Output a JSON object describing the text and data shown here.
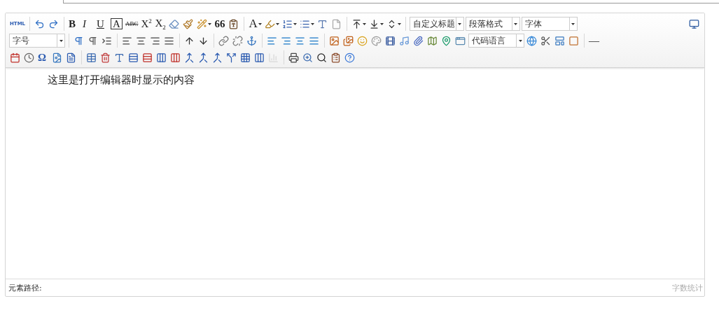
{
  "editor": {
    "toolbar": {
      "text_buttons": [
        "HTML",
        "B",
        "I",
        "U",
        "A",
        "ABC",
        "X$^{2}$",
        "X$_{2}$",
        "66",
        "A",
        "—",
        "Ω"
      ],
      "selects": [
        "自定义标题",
        "段落格式",
        "字体",
        "字号",
        "代码语言"
      ]
    },
    "content": "这里是打开编辑器时显示的内容",
    "footer": {
      "path_label": "元素路径:",
      "word_count": "字数统计"
    }
  }
}
